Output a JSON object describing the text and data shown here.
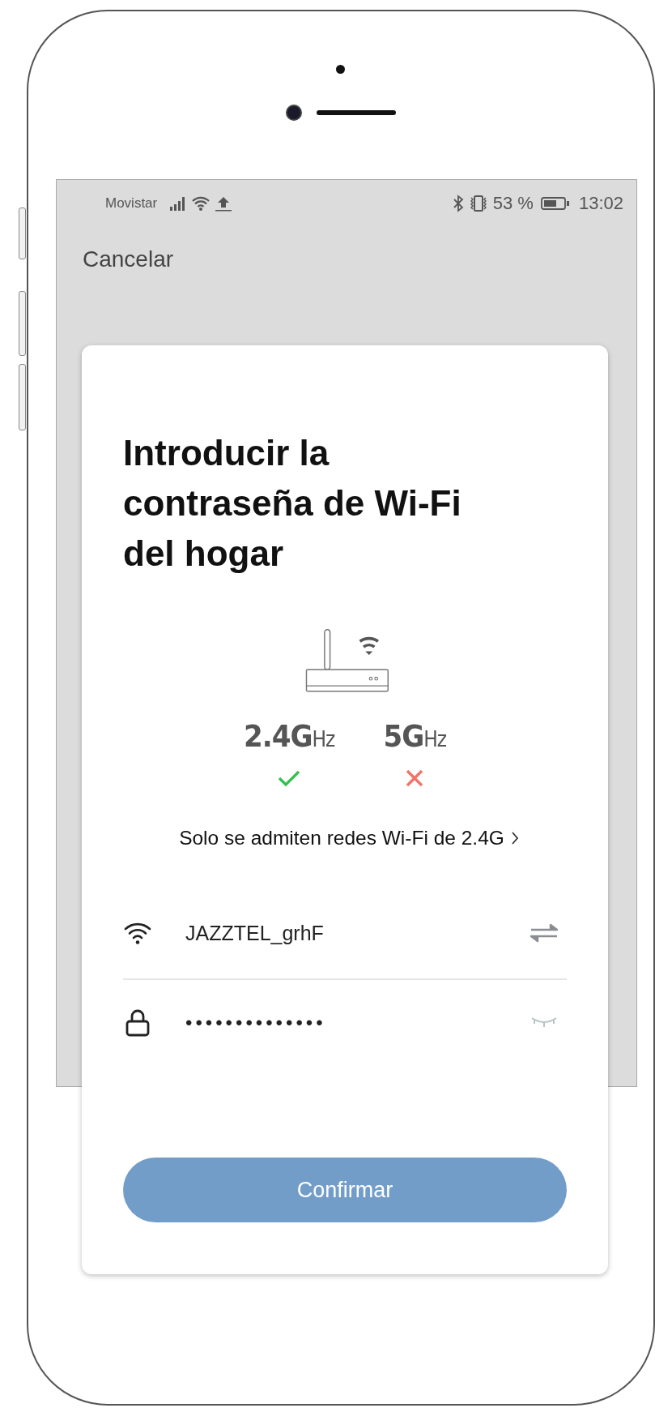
{
  "status_bar": {
    "carrier": "Movistar",
    "battery_percent": "53 %",
    "time": "13:02"
  },
  "nav": {
    "cancel": "Cancelar"
  },
  "card": {
    "title": "Introducir la contraseña de Wi-Fi del hogar",
    "frequencies": [
      {
        "label": "2.4G",
        "unit": "Hz",
        "supported": true
      },
      {
        "label": "5G",
        "unit": "Hz",
        "supported": false
      }
    ],
    "note": "Solo se admiten redes Wi-Fi de 2.4G",
    "network": {
      "ssid": "JAZZTEL_grhF"
    },
    "password": {
      "value": "••••••••••••••",
      "visible": false
    },
    "button": {
      "label": "Confirmar"
    }
  }
}
